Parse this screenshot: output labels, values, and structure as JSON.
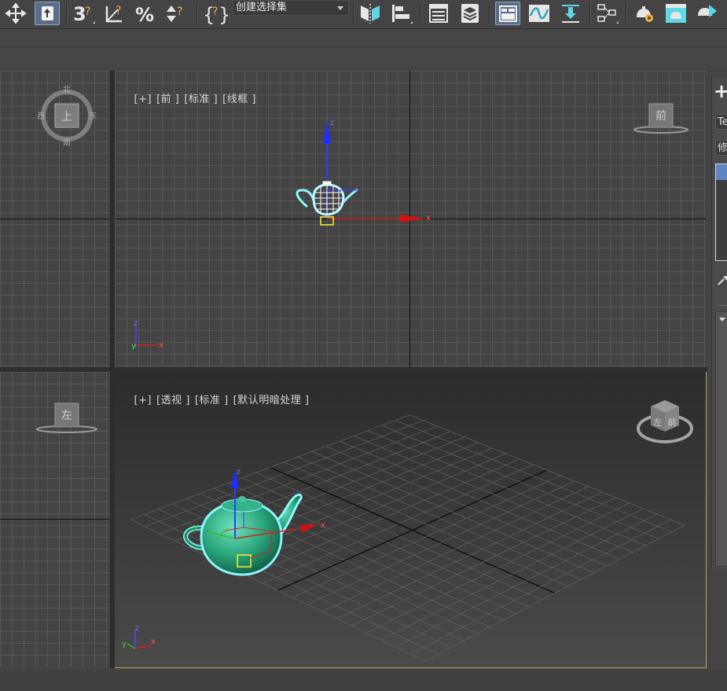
{
  "toolbar": {
    "selection_set_placeholder": "创建选择集",
    "icons": [
      "move-icon",
      "select-object-icon",
      "snap-3d-icon",
      "angle-snap-icon",
      "percent-snap-icon",
      "spinner-snap-icon",
      "edit-named-selection-icon",
      "mirror-icon",
      "align-icon",
      "scene-explorer-icon",
      "layer-explorer-icon",
      "ribbon-toggle-icon",
      "curve-editor-icon",
      "dope-sheet-icon",
      "schematic-view-icon",
      "material-editor-icon",
      "render-setup-icon",
      "render-frame-icon",
      "render-icon"
    ]
  },
  "viewports": {
    "top": {
      "viewcube_face": "上",
      "compass": {
        "n": "北",
        "s": "南",
        "e": "东",
        "w": "西"
      }
    },
    "front": {
      "labels": [
        "[+]",
        "[前 ]",
        "[标准 ]",
        "[线框 ]"
      ],
      "viewcube_face": "前",
      "gizmo_x": "x",
      "gizmo_z": "z",
      "tripod_x": "x",
      "tripod_y": "y",
      "tripod_z": "z"
    },
    "left": {
      "viewcube_face": "左"
    },
    "perspective": {
      "labels": [
        "[+]",
        "[透视 ]",
        "[标准 ]",
        "[默认明暗处理 ]"
      ],
      "viewcube_face_left": "左",
      "viewcube_face_right": "前",
      "gizmo_x": "x",
      "gizmo_y": "y",
      "gizmo_z": "z",
      "tripod_x": "x",
      "tripod_y": "y",
      "tripod_z": "z"
    }
  },
  "command_panel": {
    "create_glyph": "+",
    "name_field": "Te",
    "modifier_field": "修"
  },
  "colors": {
    "accent_blue": "#5b6c86",
    "active_viewport_border": "#bfa64d",
    "selection_outline": "#8ff4ff",
    "teapot": "#2aa57c"
  }
}
